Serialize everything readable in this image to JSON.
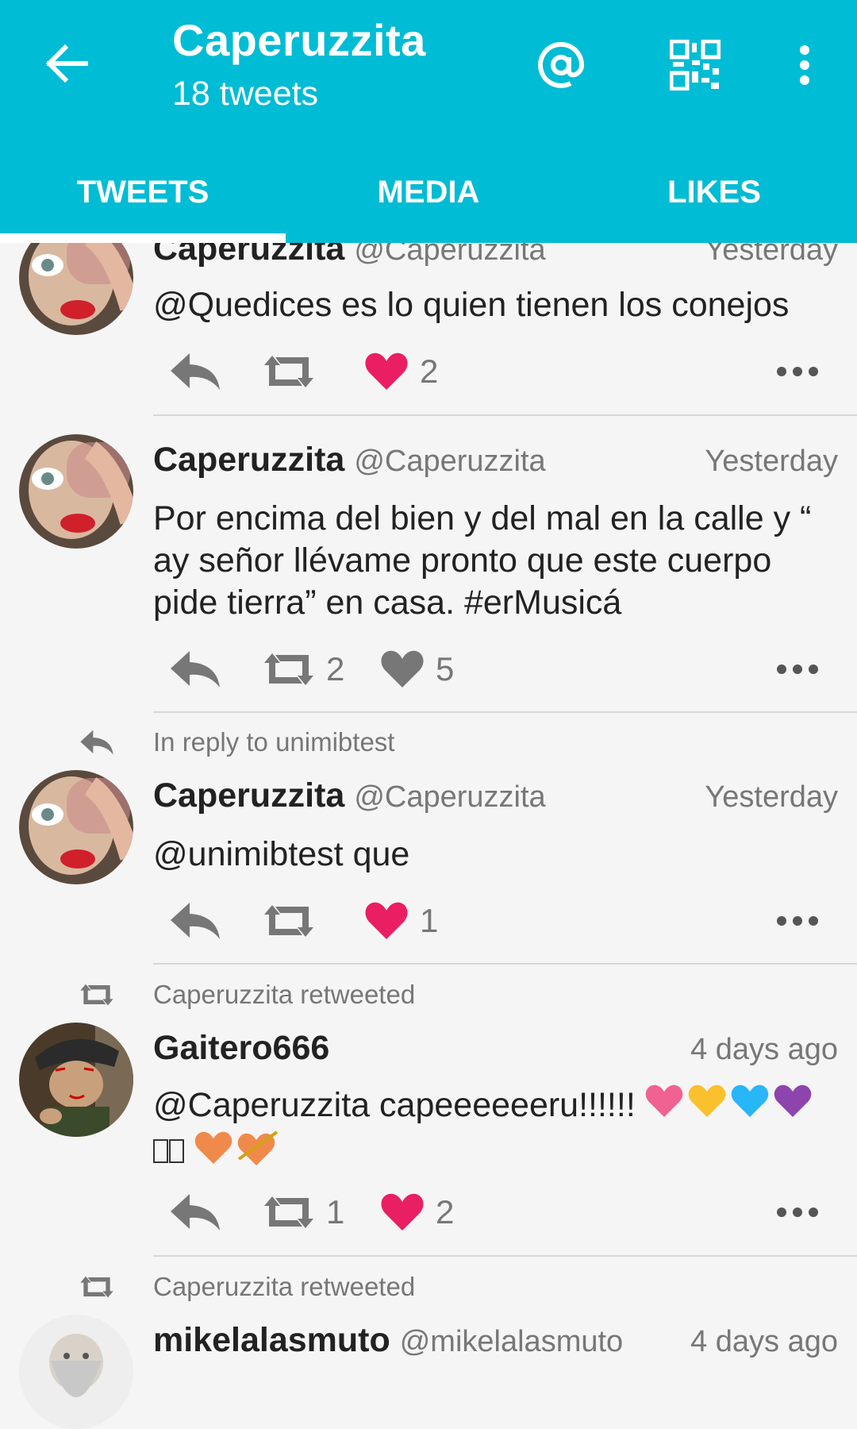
{
  "header": {
    "title": "Caperuzzita",
    "subtitle": "18 tweets",
    "icons": [
      "back-arrow-icon",
      "at-sign-icon",
      "qr-code-icon",
      "more-vert-icon"
    ],
    "accent": "#00bcd4"
  },
  "tabs": [
    {
      "label": "TWEETS",
      "active": true
    },
    {
      "label": "MEDIA",
      "active": false
    },
    {
      "label": "LIKES",
      "active": false
    }
  ],
  "tweets": [
    {
      "name": "Caperuzzita",
      "handle": "@Caperuzzita",
      "time": "Yesterday",
      "text": "@Quedices es lo quien tienen los conejos",
      "retweets": "",
      "likes": "2",
      "liked": true
    },
    {
      "name": "Caperuzzita",
      "handle": "@Caperuzzita",
      "time": "Yesterday",
      "text": "Por encima del bien y del mal en la calle y “ ay señor llévame pronto que este cuerpo pide tierra” en casa. #erMusicá",
      "retweets": "2",
      "likes": "5",
      "liked": false
    },
    {
      "context": "In reply to unimibtest",
      "name": "Caperuzzita",
      "handle": "@Caperuzzita",
      "time": "Yesterday",
      "text": "@unimibtest que",
      "retweets": "",
      "likes": "1",
      "liked": true
    },
    {
      "context": "Caperuzzita retweeted",
      "name": "Gaitero666",
      "handle": "",
      "time": "4 days ago",
      "text": "@Caperuzzita capeeeeeeru!!!!!!",
      "retweets": "1",
      "likes": "2",
      "liked": true
    },
    {
      "context": "Caperuzzita retweeted",
      "name": "mikelalasmuto",
      "handle": "@mikelalasmuto",
      "time": "4 days ago"
    }
  ],
  "colors": {
    "like": "#e91e63",
    "icon_gray": "#777777",
    "text": "#222222"
  }
}
